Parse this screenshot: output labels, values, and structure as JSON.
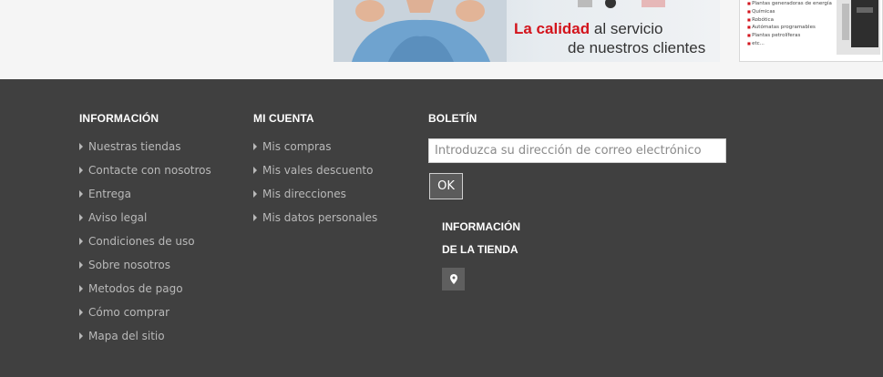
{
  "banner": {
    "highlight": "La calidad",
    "line1_rest": " al servicio",
    "line2": "de nuestros clientes",
    "side_list": [
      "Plantas generadoras de energía",
      "Químicas",
      "Robótica",
      "Autómatas programables",
      "Plantas petrolíferas",
      "etc..."
    ]
  },
  "footer": {
    "info": {
      "title": "INFORMACIÓN",
      "links": [
        "Nuestras tiendas",
        "Contacte con nosotros",
        "Entrega",
        "Aviso legal",
        "Condiciones de uso",
        "Sobre nosotros",
        "Metodos de pago",
        "Cómo comprar",
        "Mapa del sitio"
      ]
    },
    "account": {
      "title": "MI CUENTA",
      "links": [
        "Mis compras",
        "Mis vales descuento",
        "Mis direcciones",
        "Mis datos personales"
      ]
    },
    "newsletter": {
      "title": "BOLETÍN",
      "placeholder": "Introduzca su dirección de correo electrónico",
      "button": "OK"
    },
    "store": {
      "title_line1": "INFORMACIÓN",
      "title_line2": "DE LA TIENDA",
      "icon": "map-marker-icon"
    }
  },
  "colors": {
    "footer_bg": "#404040",
    "accent_red": "#d3141c",
    "link_text": "#b9b9b9"
  }
}
